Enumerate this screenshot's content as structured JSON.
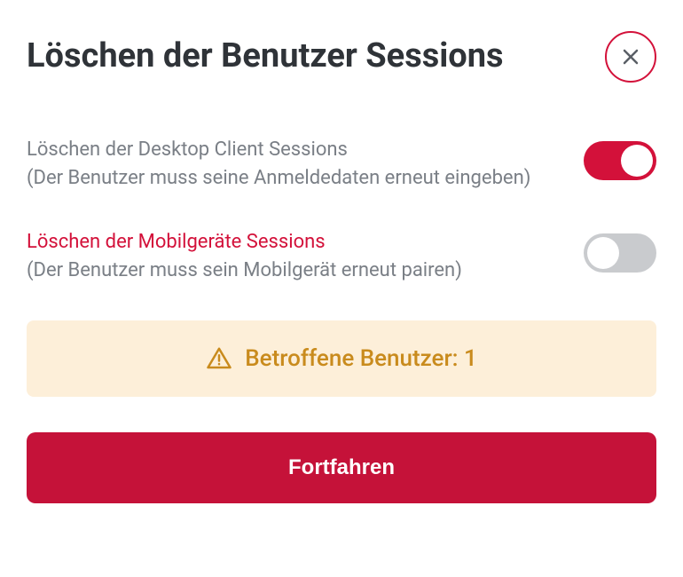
{
  "dialog": {
    "title": "Löschen der Benutzer Sessions",
    "options": [
      {
        "label": "Löschen der Desktop Client Sessions",
        "desc": "(Der Benutzer muss seine Anmeldedaten erneut eingeben)",
        "on": true,
        "warn": false
      },
      {
        "label": "Löschen der Mobilgeräte Sessions",
        "desc": "(Der Benutzer muss sein Mobilgerät erneut pairen)",
        "on": false,
        "warn": true
      }
    ],
    "banner": {
      "text": "Betroffene Benutzer: 1"
    },
    "primary_button": "Fortfahren"
  }
}
